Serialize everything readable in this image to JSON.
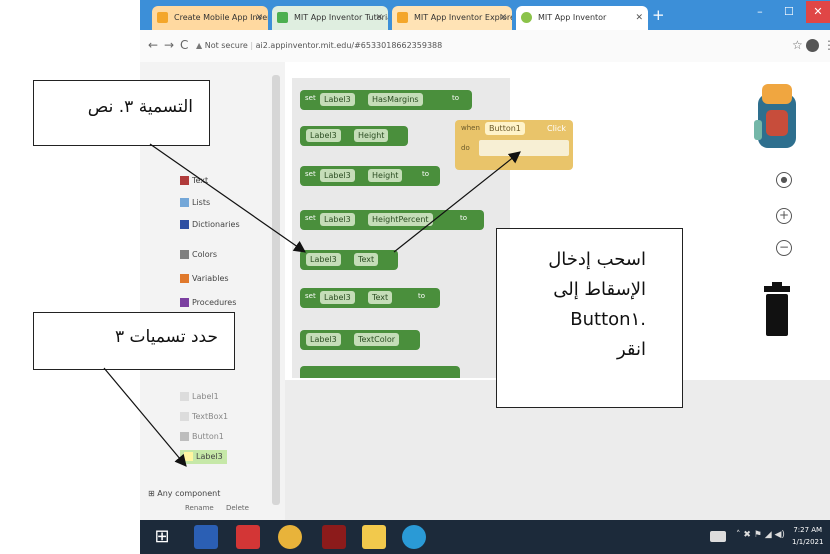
{
  "browser": {
    "tabs": [
      {
        "label": "Create Mobile App Inventor",
        "favicon_color": "#f4a62a"
      },
      {
        "label": "MIT App Inventor Tutorials",
        "favicon_color": "#4caf50"
      },
      {
        "label": "MIT App Inventor Explore",
        "favicon_color": "#f4a62a"
      },
      {
        "label": "MIT App Inventor",
        "favicon_color": "#8bc34a"
      }
    ],
    "new_tab_icon": "plus-icon",
    "security_label": "Not secure",
    "url": "ai2.appinventor.mit.edu/#6533018662359388"
  },
  "sidebar": {
    "items": [
      {
        "label": "Text",
        "color": "#b03b3b"
      },
      {
        "label": "Lists",
        "color": "#74a7d8"
      },
      {
        "label": "Dictionaries",
        "color": "#2d4ea2"
      },
      {
        "label": "Colors",
        "color": "#808080"
      },
      {
        "label": "Variables",
        "color": "#e0792c"
      },
      {
        "label": "Procedures",
        "color": "#7b3fa0"
      }
    ],
    "components": [
      {
        "label": "Label1"
      },
      {
        "label": "TextBox1"
      },
      {
        "label": "Button1"
      },
      {
        "label": "Label3"
      }
    ],
    "any_component": "Any component",
    "bottom_buttons": [
      "Rename",
      "Delete"
    ]
  },
  "blocks": {
    "label3": "Label3",
    "set_word": "set",
    "to_word": "to",
    "rows": [
      {
        "kind": "setter",
        "prop": "HasMargins"
      },
      {
        "kind": "getter",
        "prop": "Height"
      },
      {
        "kind": "setter",
        "prop": "Height"
      },
      {
        "kind": "setter",
        "prop": "HeightPercent"
      },
      {
        "kind": "getter",
        "prop": "Text"
      },
      {
        "kind": "setter",
        "prop": "Text"
      },
      {
        "kind": "getter",
        "prop": "TextColor"
      }
    ],
    "event": {
      "when": "when",
      "component": "Button1",
      "event": "Click",
      "do": "do"
    }
  },
  "annotations": {
    "label_text": "التسمية ٣. نص",
    "select_labels": "حدد تسميات ٣",
    "drag_drop_lines": [
      "اسحب إدخال",
      "الإسقاط إلى",
      ".Button١",
      "انقر"
    ]
  },
  "taskbar": {
    "time": "7:27 AM",
    "date": "1/1/2021"
  },
  "colors": {
    "tabbar": "#3c8fd8",
    "block_green": "#4a8f3c",
    "event_gold": "#e9c46a"
  }
}
